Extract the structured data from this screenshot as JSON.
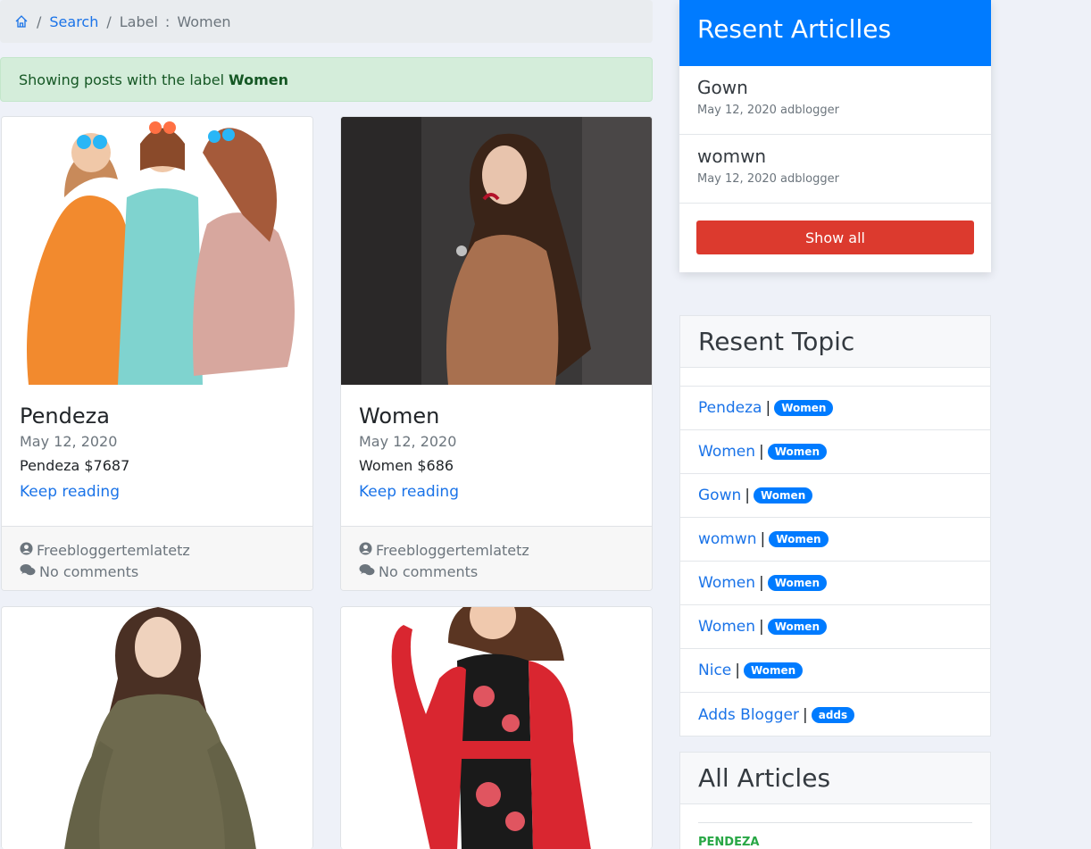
{
  "breadcrumb": {
    "home_icon": "home-icon",
    "sep": "/",
    "search": "Search",
    "label_prefix": "Label",
    "colon": ":",
    "label_value": "Women"
  },
  "alert": {
    "text": "Showing posts with the label",
    "label": "Women"
  },
  "cards": [
    {
      "title": "Pendeza",
      "date": "May 12, 2020",
      "excerpt": "Pendeza $7687",
      "more": "Keep reading",
      "author": "Freebloggertemlatetz",
      "comments": "No comments"
    },
    {
      "title": "Women",
      "date": "May 12, 2020",
      "excerpt": "Women $686",
      "more": "Keep reading",
      "author": "Freebloggertemlatetz",
      "comments": "No comments"
    }
  ],
  "recent_articles": {
    "title": "Resent Articlles",
    "items": [
      {
        "title": "Gown",
        "meta": "May 12, 2020 adblogger"
      },
      {
        "title": "womwn",
        "meta": "May 12, 2020 adblogger"
      }
    ],
    "show_all": "Show all"
  },
  "recent_topic": {
    "title": "Resent Topic",
    "items": [
      {
        "label": "Pendeza",
        "badge": "Women"
      },
      {
        "label": "Women",
        "badge": "Women"
      },
      {
        "label": "Gown",
        "badge": "Women"
      },
      {
        "label": "womwn",
        "badge": "Women"
      },
      {
        "label": "Women",
        "badge": "Women"
      },
      {
        "label": "Women",
        "badge": "Women"
      },
      {
        "label": "Nice",
        "badge": "Women"
      },
      {
        "label": "Adds Blogger",
        "badge": "adds"
      }
    ]
  },
  "all_articles": {
    "title": "All Articles",
    "first_label": "PENDEZA"
  },
  "colors": {
    "primary": "#007bff",
    "danger": "#dc3a2e",
    "link": "#1a73e8",
    "success": "#28a745"
  }
}
